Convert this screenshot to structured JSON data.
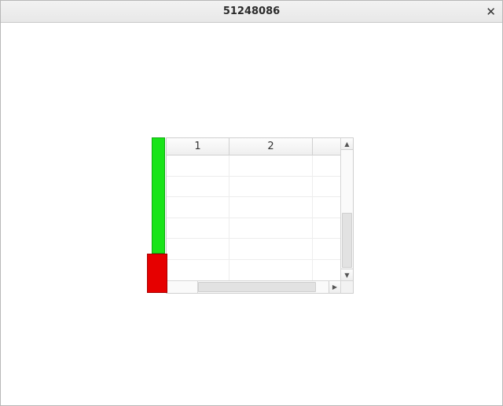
{
  "window": {
    "title": "51248086"
  },
  "table": {
    "headers": [
      "1",
      "2",
      ""
    ],
    "rows": [
      [
        "",
        "",
        ""
      ],
      [
        "",
        "",
        ""
      ],
      [
        "",
        "",
        ""
      ],
      [
        "",
        "",
        ""
      ],
      [
        "",
        "",
        ""
      ],
      [
        "",
        "",
        ""
      ]
    ]
  },
  "colors": {
    "green": "#18e418",
    "red": "#e60000"
  }
}
